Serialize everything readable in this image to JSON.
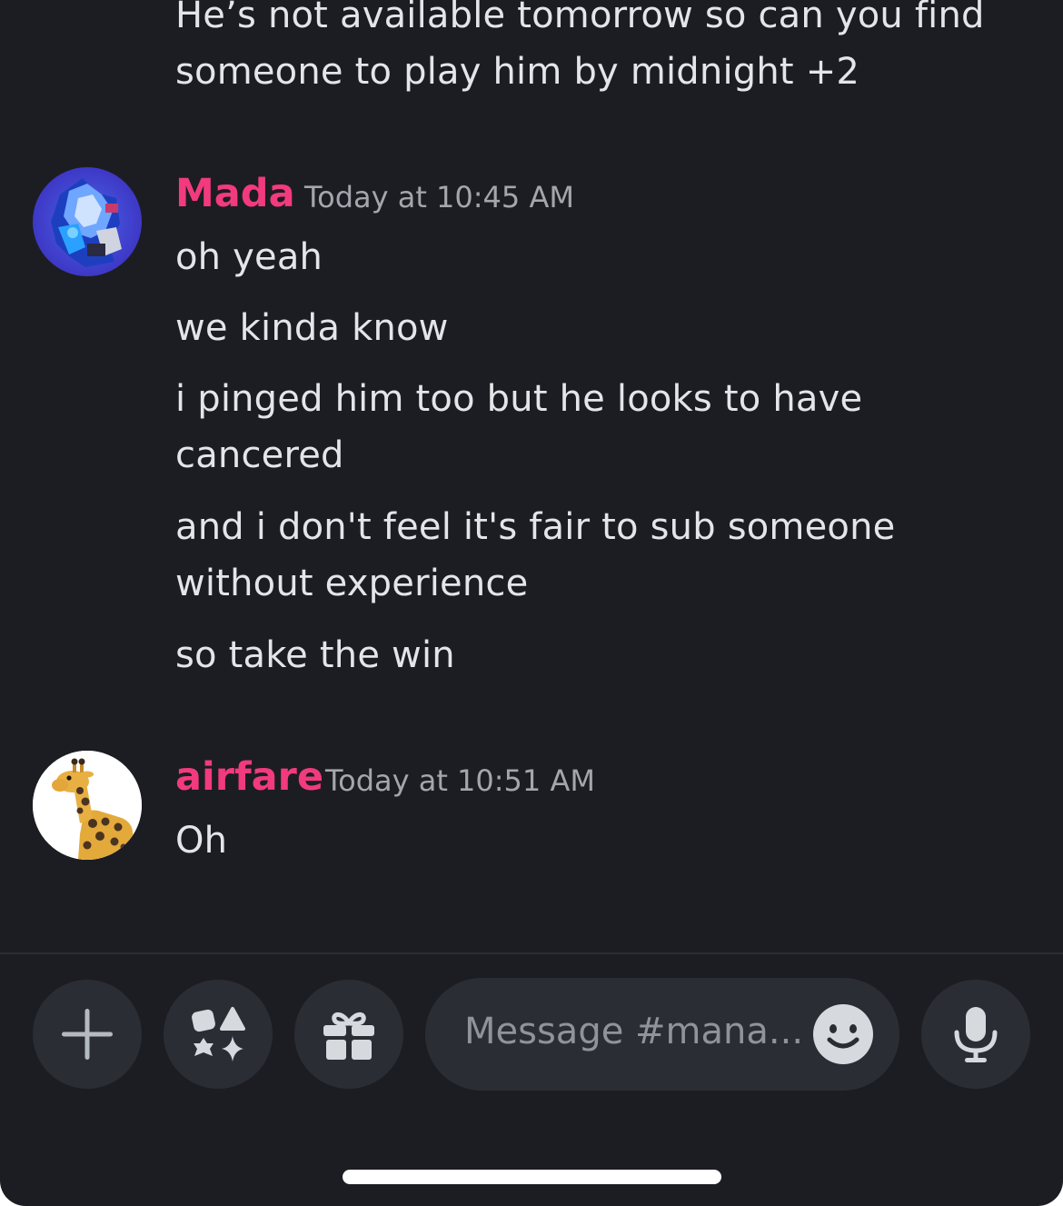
{
  "top_message": {
    "lines": [
      "He’s not available tomorrow so can you find",
      "someone to play him by midnight +2"
    ]
  },
  "messages": [
    {
      "author": "Mada",
      "timestamp": "Today at 10:45 AM",
      "avatar_icon": "robot-avatar-icon",
      "lines": [
        "oh yeah",
        "we kinda know",
        "i pinged him too but he looks to have",
        "cancered",
        "and i don't feel it's fair to sub someone",
        "without experience",
        "so take the win"
      ]
    },
    {
      "author": "airfare",
      "timestamp": "Today at 10:51 AM",
      "avatar_icon": "giraffe-avatar-icon",
      "lines": [
        "Oh"
      ]
    }
  ],
  "composer": {
    "placeholder": "Message #mana...",
    "buttons": [
      "plus-icon",
      "apps-icon",
      "gift-icon",
      "emoji-icon",
      "microphone-icon"
    ]
  },
  "colors": {
    "background": "#1c1d22",
    "username": "#f23a7f",
    "timestamp": "#a3a6ad",
    "text": "#e3e5e8",
    "input_bg": "#2b2d34"
  }
}
